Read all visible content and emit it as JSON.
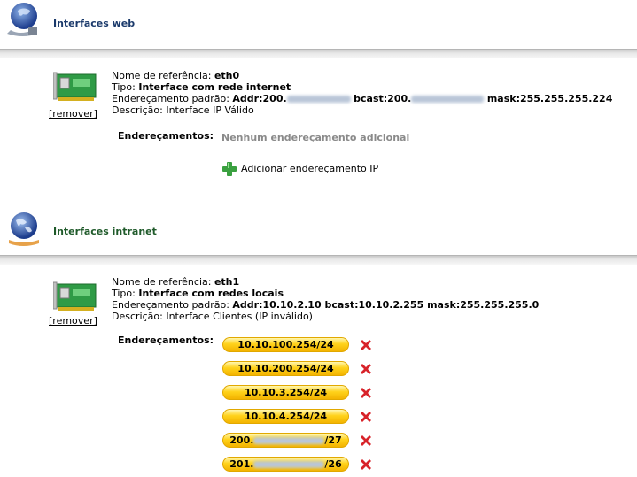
{
  "web": {
    "title": "Interfaces web",
    "interface": {
      "remove_label": "[remover]",
      "ref_label": "Nome de referência:",
      "ref_value": "eth0",
      "type_label": "Tipo:",
      "type_value": "Interface com rede internet",
      "addr_label": "Endereçamento padrão:",
      "addr_prefix": "Addr:200.",
      "bcast_prefix": "bcast:200.",
      "mask_value": "mask:255.255.255.224",
      "desc_label": "Descrição:",
      "desc_value": "Interface IP Válido",
      "addresses_label": "Endereçamentos:",
      "no_addresses": "Nenhum endereçamento adicional",
      "add_ip_label": "Adicionar endereçamento IP"
    }
  },
  "intranet": {
    "title": "Interfaces intranet",
    "interface": {
      "remove_label": "[remover]",
      "ref_label": "Nome de referência:",
      "ref_value": "eth1",
      "type_label": "Tipo:",
      "type_value": "Interface com redes locais",
      "addr_label": "Endereçamento padrão:",
      "addr_value": "Addr:10.10.2.10 bcast:10.10.2.255 mask:255.255.255.0",
      "desc_label": "Descrição:",
      "desc_value": "Interface Clientes (IP inválido)",
      "addresses_label": "Endereçamentos:",
      "addresses": [
        "10.10.100.254/24",
        "10.10.200.254/24",
        "10.10.3.254/24",
        "10.10.4.254/24",
        "200.",
        "201."
      ],
      "addr5_suffix": "/27",
      "addr6_suffix": "/26"
    }
  }
}
